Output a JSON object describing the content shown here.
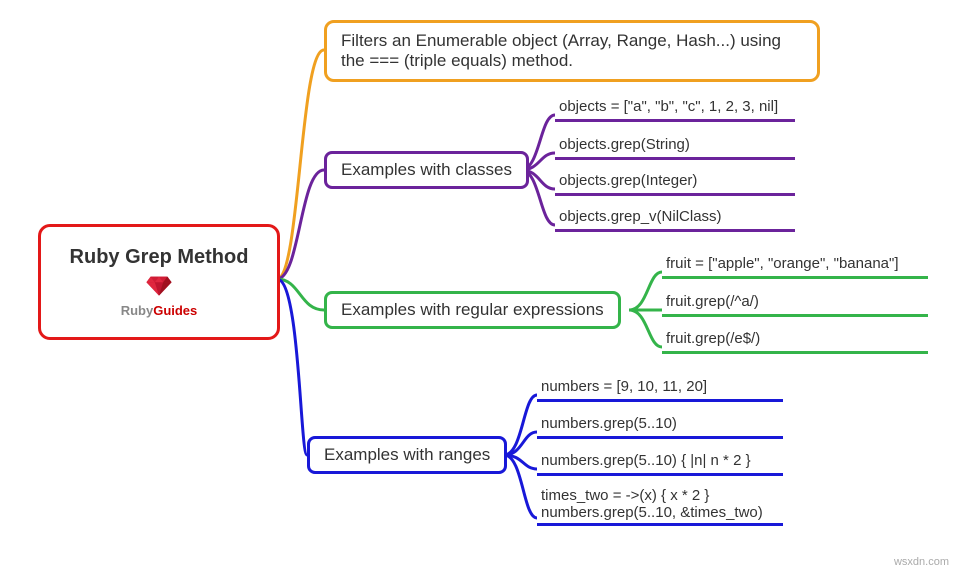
{
  "root": {
    "title": "Ruby Grep Method",
    "subtitle_gray": "Ruby",
    "subtitle_red": "Guides"
  },
  "description": "Filters an Enumerable object (Array, Range, Hash...) using the === (triple equals) method.",
  "branches": {
    "classes": {
      "label": "Examples with classes",
      "leaves": [
        "objects = [\"a\", \"b\", \"c\", 1, 2, 3, nil]",
        "objects.grep(String)",
        "objects.grep(Integer)",
        "objects.grep_v(NilClass)"
      ]
    },
    "regex": {
      "label": "Examples with regular expressions",
      "leaves": [
        "fruit = [\"apple\", \"orange\", \"banana\"]",
        "fruit.grep(/^a/)",
        "fruit.grep(/e$/)"
      ]
    },
    "ranges": {
      "label": "Examples with ranges",
      "leaves": [
        "numbers = [9, 10, 11, 20]",
        "numbers.grep(5..10)",
        "numbers.grep(5..10) { |n| n * 2 }"
      ],
      "leaf_multiline": {
        "line1": "times_two = ->(x) { x * 2 }",
        "line2": "numbers.grep(5..10, &times_two)"
      }
    }
  },
  "watermark": "wsxdn.com",
  "colors": {
    "red": "#e31818",
    "orange": "#f0a020",
    "purple": "#6b239b",
    "green": "#34b44a",
    "blue": "#1818d8"
  }
}
